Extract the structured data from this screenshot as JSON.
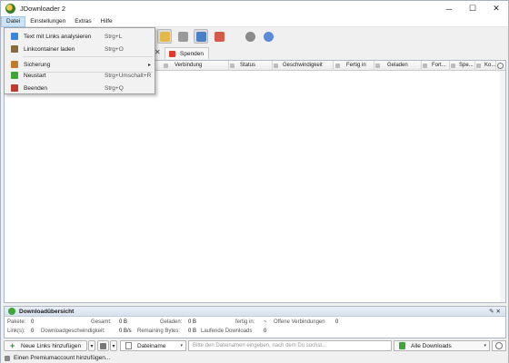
{
  "window": {
    "title": "JDownloader 2",
    "minimize": "─",
    "maximize": "☐",
    "close": "✕"
  },
  "menubar": {
    "items": [
      "Datei",
      "Einstellungen",
      "Extras",
      "Hilfe"
    ]
  },
  "file_menu": {
    "items": [
      {
        "label": "Text mit Links analysieren",
        "shortcut": "Strg+L",
        "icon": "add-links-icon",
        "color": "#3a86d8"
      },
      {
        "label": "Linkcontainer laden",
        "shortcut": "Strg+O",
        "icon": "container-icon",
        "color": "#8a6a3a"
      },
      {
        "label": "Sicherung",
        "shortcut": "",
        "icon": "backup-icon",
        "color": "#c07a2a",
        "submenu": "▸"
      },
      {
        "label": "Neustart",
        "shortcut": "Strg+Umschalt+R",
        "icon": "restart-icon",
        "color": "#3fa73a"
      },
      {
        "label": "Beenden",
        "shortcut": "Strg+Q",
        "icon": "exit-icon",
        "color": "#c0392b"
      }
    ]
  },
  "tabs": {
    "close_glyph": "✕",
    "donate_label": "Spenden"
  },
  "table": {
    "columns": [
      "Verbindung",
      "Status",
      "Geschwindigkeit",
      "Fertig in",
      "Geladen",
      "Fort...",
      "Spe...",
      "Ko..."
    ]
  },
  "overview": {
    "title": "Downloadübersicht",
    "controls": "✎✕",
    "row1": [
      {
        "label": "Pakete:",
        "value": "0"
      },
      {
        "label": "Gesamt:",
        "value": "0 B"
      },
      {
        "label": "Geladen:",
        "value": "0 B"
      },
      {
        "label": "fertig in:",
        "value": "~"
      },
      {
        "label": "Offene Verbindungen",
        "value": "0"
      }
    ],
    "row2": [
      {
        "label": "Link(s):",
        "value": "0"
      },
      {
        "label": "Downloadgeschwindigkeit:",
        "value": "0 B/s"
      },
      {
        "label": "Remaining Bytes:",
        "value": "0 B"
      },
      {
        "label": "Laufende Downloads",
        "value": "0"
      }
    ]
  },
  "bottombar": {
    "add_links": "Neue Links hinzufügen",
    "sort_field": "Dateiname",
    "search_placeholder": "Bitte den Dateinamen eingeben, nach dem Du suchst...",
    "view": "Alle Downloads",
    "arrow": "▾"
  },
  "statusbar": {
    "text": "Einen Premiumaccount hinzufügen..."
  }
}
